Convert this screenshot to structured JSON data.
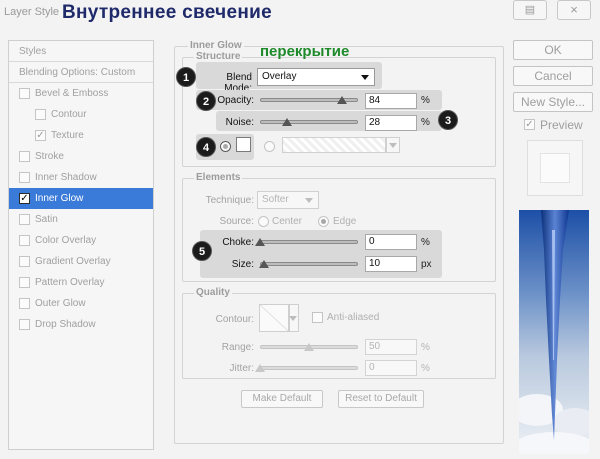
{
  "window": {
    "title": "Layer Style",
    "annotation_title": "Внутреннее свечение"
  },
  "styles_panel": {
    "header": "Styles",
    "items": [
      {
        "label": "Blending Options: Custom",
        "checkbox": false,
        "checked": false,
        "selected": false
      },
      {
        "label": "Bevel & Emboss",
        "checkbox": true,
        "checked": false,
        "selected": false
      },
      {
        "label": "Contour",
        "checkbox": true,
        "checked": false,
        "selected": false,
        "indent": true
      },
      {
        "label": "Texture",
        "checkbox": true,
        "checked": true,
        "selected": false,
        "indent": true
      },
      {
        "label": "Stroke",
        "checkbox": true,
        "checked": false,
        "selected": false
      },
      {
        "label": "Inner Shadow",
        "checkbox": true,
        "checked": false,
        "selected": false
      },
      {
        "label": "Inner Glow",
        "checkbox": true,
        "checked": true,
        "selected": true
      },
      {
        "label": "Satin",
        "checkbox": true,
        "checked": false,
        "selected": false
      },
      {
        "label": "Color Overlay",
        "checkbox": true,
        "checked": false,
        "selected": false
      },
      {
        "label": "Gradient Overlay",
        "checkbox": true,
        "checked": false,
        "selected": false
      },
      {
        "label": "Pattern Overlay",
        "checkbox": true,
        "checked": false,
        "selected": false
      },
      {
        "label": "Outer Glow",
        "checkbox": true,
        "checked": false,
        "selected": false
      },
      {
        "label": "Drop Shadow",
        "checkbox": true,
        "checked": false,
        "selected": false
      }
    ]
  },
  "inner_glow": {
    "title": "Inner Glow",
    "structure": {
      "legend": "Structure",
      "annotation": "перекрытие",
      "blend_mode_label": "Blend Mode:",
      "blend_mode_value": "Overlay",
      "opacity_label": "Opacity:",
      "opacity_value": "84",
      "opacity_level": 0.84,
      "opacity_unit": "%",
      "noise_label": "Noise:",
      "noise_value": "28",
      "noise_level": 0.28,
      "noise_unit": "%"
    },
    "elements": {
      "legend": "Elements",
      "technique_label": "Technique:",
      "technique_value": "Softer",
      "source_label": "Source:",
      "source_center": "Center",
      "source_edge": "Edge",
      "choke_label": "Choke:",
      "choke_value": "0",
      "choke_level": 0.0,
      "choke_unit": "%",
      "size_label": "Size:",
      "size_value": "10",
      "size_level": 0.04,
      "size_unit": "px"
    },
    "quality": {
      "legend": "Quality",
      "contour_label": "Contour:",
      "anti_aliased_label": "Anti-aliased",
      "range_label": "Range:",
      "range_value": "50",
      "range_level": 0.5,
      "range_unit": "%",
      "jitter_label": "Jitter:",
      "jitter_value": "0",
      "jitter_level": 0.0,
      "jitter_unit": "%"
    },
    "make_default": "Make Default",
    "reset_default": "Reset to Default"
  },
  "badges": [
    "1",
    "2",
    "3",
    "4",
    "5"
  ],
  "actions": {
    "ok": "OK",
    "cancel": "Cancel",
    "new_style": "New Style...",
    "preview_label": "Preview",
    "preview_checked": true
  },
  "colors": {
    "accent": "#3a7ad8",
    "annotation_title": "#1f2a6b",
    "annotation_green": "#1e8a2a",
    "badge": "#1b1b1b"
  }
}
